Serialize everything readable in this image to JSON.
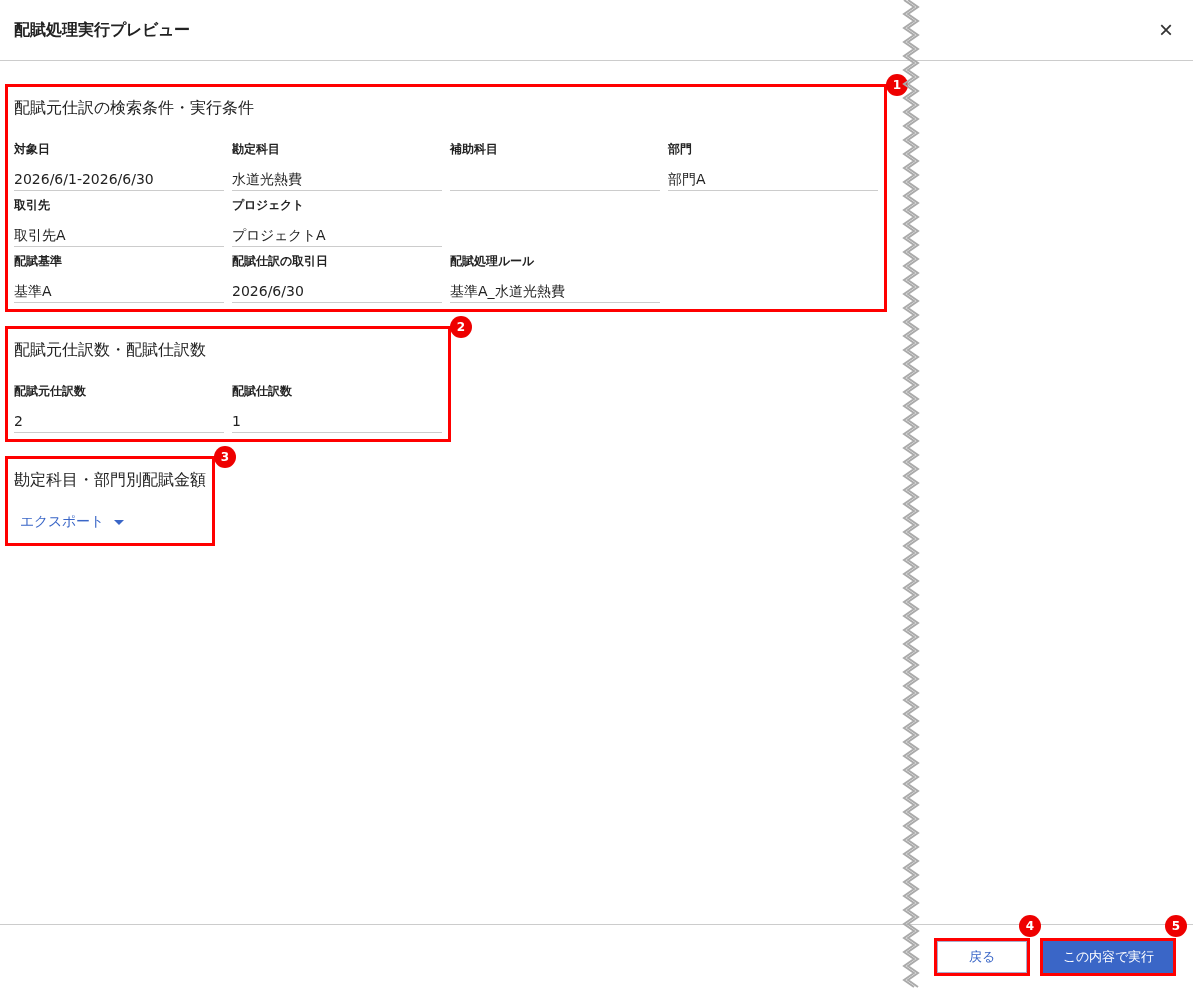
{
  "dialog": {
    "title": "配賦処理実行プレビュー",
    "close_icon": "×"
  },
  "sections": [
    {
      "title": "配賦元仕訳の検索条件・実行条件",
      "callout": "1",
      "rows": [
        [
          {
            "label": "対象日",
            "value": "2026/6/1-2026/6/30"
          },
          {
            "label": "勘定科目",
            "value": "水道光熱費"
          },
          {
            "label": "補助科目"
          },
          {
            "label": "部門",
            "value": "部門A"
          }
        ],
        [
          {
            "label": "取引先",
            "value": "取引先A"
          },
          {
            "label": "プロジェクト",
            "value": "プロジェクトA"
          }
        ],
        [
          {
            "label": "配賦基準",
            "value": "基準A"
          },
          {
            "label": "配賦仕訳の取引日",
            "value": "2026/6/30"
          },
          {
            "label": "配賦処理ルール",
            "value": "基準A_水道光熱費"
          }
        ]
      ]
    },
    {
      "title": "配賦元仕訳数・配賦仕訳数",
      "callout": "2",
      "rows": [
        [
          {
            "label": "配賦元仕訳数",
            "value": "2"
          },
          {
            "label": "配賦仕訳数",
            "value": "1"
          }
        ]
      ]
    },
    {
      "title": "勘定科目・部門別配賦金額",
      "callout": "3",
      "export_menu": {
        "label": "エクスポート"
      }
    }
  ],
  "buttons": [
    {
      "label": "戻る",
      "kind": "secondary",
      "callout": "4"
    },
    {
      "label": "この内容で実行",
      "kind": "primary",
      "callout": "5"
    }
  ]
}
